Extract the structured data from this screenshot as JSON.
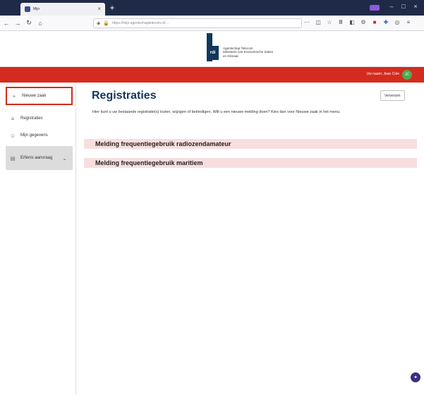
{
  "browser": {
    "tab_title": "Mijn",
    "new_tab": "+",
    "url": "https://mijn.agentschaptelecom.nl/…",
    "url_domain": "agentschaptelecom.nl",
    "window_controls": [
      "–",
      "□",
      "×"
    ]
  },
  "header": {
    "logo_mark": "rdi",
    "logo_lines": [
      "Agentschap Telecom",
      "Ministerie van Economische Zaken",
      "en Klimaat"
    ]
  },
  "userbar": {
    "user_name": "Uw naam: Jean Cole",
    "avatar_initials": "JC"
  },
  "sidebar": {
    "items": [
      {
        "label": "Nieuwe zaak",
        "icon": "plus-icon"
      },
      {
        "label": "Registraties",
        "icon": "list-icon"
      },
      {
        "label": "Mijn gegevens",
        "icon": "user-icon"
      },
      {
        "label": "Erfenis aanvraag",
        "icon": "folder-icon"
      }
    ]
  },
  "main": {
    "title": "Registraties",
    "login_button": "Verversen",
    "intro": "Hier kunt u uw bestaande registratie(s) inzien, wijzigen of beëindigen. Wilt u een nieuwe melding doen? Kies dan voor Nieuwe zaak in het menu.",
    "registrations": [
      {
        "label": "Melding frequentiegebruik radiozendamateur"
      },
      {
        "label": "Melding frequentiegebruik maritiem"
      }
    ]
  },
  "colors": {
    "brand_red": "#d52b1e",
    "title_blue": "#12375a",
    "item_pink": "#f8dede"
  }
}
